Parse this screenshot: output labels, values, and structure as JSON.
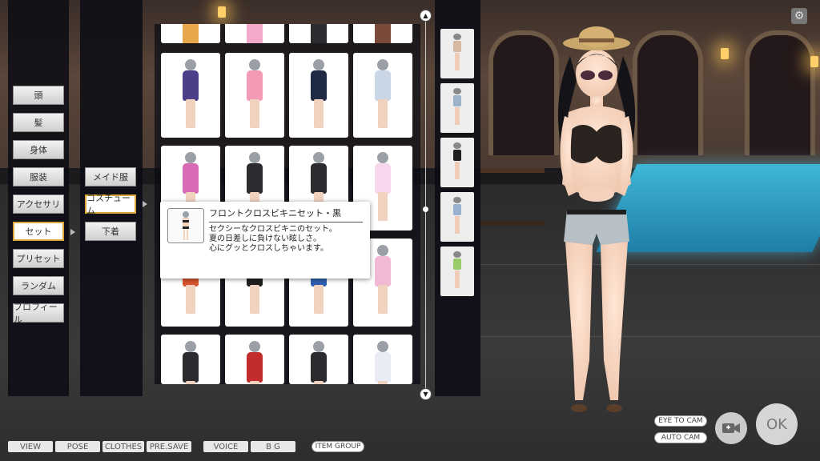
{
  "categories": [
    {
      "label": "頭",
      "active": false
    },
    {
      "label": "髪",
      "active": false
    },
    {
      "label": "身体",
      "active": false
    },
    {
      "label": "服装",
      "active": false
    },
    {
      "label": "アクセサリ",
      "active": false
    },
    {
      "label": "セット",
      "active": true
    },
    {
      "label": "プリセット",
      "active": false
    },
    {
      "label": "ランダム",
      "active": false
    },
    {
      "label": "プロフィール",
      "active": false
    }
  ],
  "subcategories": [
    {
      "label": "メイド服",
      "active": false
    },
    {
      "label": "コスチューム",
      "active": true
    },
    {
      "label": "下着",
      "active": false
    }
  ],
  "tooltip": {
    "title": "フロントクロスビキニセット・黒",
    "desc_line1": "セクシーなクロスビキニのセット。",
    "desc_line2": "夏の日差しに負けない眩しさ。",
    "desc_line3": "心にグッとクロスしちゃいます。"
  },
  "grid_outfit_colors": [
    [
      "#e8a74a",
      "#f3a9c9",
      "#2b2b30",
      "#7a4a3a"
    ],
    [
      "#4b3f8a",
      "#f39ab5",
      "#1f2a44",
      "#c9d6e6"
    ],
    [
      "#d86bb6",
      "#2b2b30",
      "#2b2b30",
      "#f7d7ee"
    ],
    [
      "#d8542e",
      "#1f1f1f",
      "#2f5fb0",
      "#f2b9d4"
    ],
    [
      "#2b2b30",
      "#c22c2c",
      "#2b2b30",
      "#e9ecf5"
    ]
  ],
  "right_list_colors": [
    "#d7b8a0",
    "#9fb3c8",
    "#1f1f1f",
    "#9ab0d0",
    "#9acb6a"
  ],
  "bottom_bar": {
    "view": "VIEW",
    "pose": "POSE",
    "clothes": "CLOTHES",
    "presave": "PRE.SAVE",
    "voice": "VOICE",
    "bg": "B G",
    "item_group": "ITEM GROUP"
  },
  "camera_controls": {
    "eye_to_cam": "EYE TO CAM",
    "auto_cam": "AUTO CAM",
    "ok": "OK"
  },
  "icons": {
    "settings": "gear-icon",
    "camera": "camera-icon",
    "scroll_up": "chevron-up-icon",
    "scroll_down": "chevron-down-icon"
  }
}
